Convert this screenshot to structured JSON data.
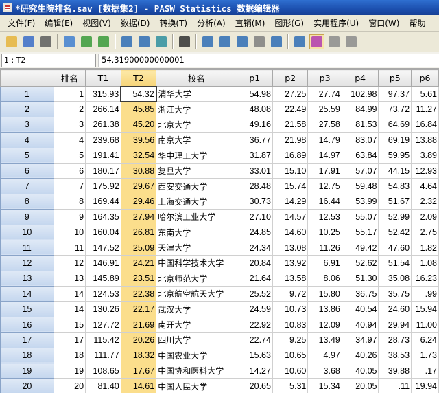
{
  "title": "*研究生院排名.sav [数据集2] - PASW Statistics 数据编辑器",
  "menu": [
    "文件(F)",
    "编辑(E)",
    "视图(V)",
    "数据(D)",
    "转换(T)",
    "分析(A)",
    "直销(M)",
    "图形(G)",
    "实用程序(U)",
    "窗口(W)",
    "帮助"
  ],
  "toolbar_icons": [
    "open-folder-icon",
    "save-icon",
    "print-icon",
    "dialog-recall-icon",
    "undo-icon",
    "redo-icon",
    "goto-case-icon",
    "goto-variable-icon",
    "variables-icon",
    "find-icon",
    "insert-cases-icon",
    "insert-variable-icon",
    "split-file-icon",
    "weight-cases-icon",
    "select-cases-icon",
    "value-labels-icon",
    "use-sets-icon",
    "show-all-variables-icon",
    "spell-check-icon"
  ],
  "cell_ref": "1 : T2",
  "cell_value": "54.31900000000001",
  "columns": [
    "排名",
    "T1",
    "T2",
    "校名",
    "p1",
    "p2",
    "p3",
    "p4",
    "p5",
    "p6"
  ],
  "rows": [
    {
      "n": "1",
      "v": [
        "1",
        "315.93",
        "54.32",
        "清华大学",
        "54.98",
        "27.25",
        "27.74",
        "102.98",
        "97.37",
        "5.61"
      ]
    },
    {
      "n": "2",
      "v": [
        "2",
        "266.14",
        "45.85",
        "浙江大学",
        "48.08",
        "22.49",
        "25.59",
        "84.99",
        "73.72",
        "11.27"
      ]
    },
    {
      "n": "3",
      "v": [
        "3",
        "261.38",
        "45.20",
        "北京大学",
        "49.16",
        "21.58",
        "27.58",
        "81.53",
        "64.69",
        "16.84"
      ]
    },
    {
      "n": "4",
      "v": [
        "4",
        "239.68",
        "39.56",
        "南京大学",
        "36.77",
        "21.98",
        "14.79",
        "83.07",
        "69.19",
        "13.88"
      ]
    },
    {
      "n": "5",
      "v": [
        "5",
        "191.41",
        "32.54",
        "华中理工大学",
        "31.87",
        "16.89",
        "14.97",
        "63.84",
        "59.95",
        "3.89"
      ]
    },
    {
      "n": "6",
      "v": [
        "6",
        "180.17",
        "30.88",
        "复旦大学",
        "33.01",
        "15.10",
        "17.91",
        "57.07",
        "44.15",
        "12.93"
      ]
    },
    {
      "n": "7",
      "v": [
        "7",
        "175.92",
        "29.67",
        "西安交通大学",
        "28.48",
        "15.74",
        "12.75",
        "59.48",
        "54.83",
        "4.64"
      ]
    },
    {
      "n": "8",
      "v": [
        "8",
        "169.44",
        "29.46",
        "上海交通大学",
        "30.73",
        "14.29",
        "16.44",
        "53.99",
        "51.67",
        "2.32"
      ]
    },
    {
      "n": "9",
      "v": [
        "9",
        "164.35",
        "27.94",
        "哈尔滨工业大学",
        "27.10",
        "14.57",
        "12.53",
        "55.07",
        "52.99",
        "2.09"
      ]
    },
    {
      "n": "10",
      "v": [
        "10",
        "160.04",
        "26.81",
        "东南大学",
        "24.85",
        "14.60",
        "10.25",
        "55.17",
        "52.42",
        "2.75"
      ]
    },
    {
      "n": "11",
      "v": [
        "11",
        "147.52",
        "25.09",
        "天津大学",
        "24.34",
        "13.08",
        "11.26",
        "49.42",
        "47.60",
        "1.82"
      ]
    },
    {
      "n": "12",
      "v": [
        "12",
        "146.91",
        "24.21",
        "中国科学技术大学",
        "20.84",
        "13.92",
        "6.91",
        "52.62",
        "51.54",
        "1.08"
      ]
    },
    {
      "n": "13",
      "v": [
        "13",
        "145.89",
        "23.51",
        "北京师范大学",
        "21.64",
        "13.58",
        "8.06",
        "51.30",
        "35.08",
        "16.23"
      ]
    },
    {
      "n": "14",
      "v": [
        "14",
        "124.53",
        "22.38",
        "北京航空航天大学",
        "25.52",
        "9.72",
        "15.80",
        "36.75",
        "35.75",
        ".99"
      ]
    },
    {
      "n": "15",
      "v": [
        "14",
        "130.26",
        "22.17",
        "武汉大学",
        "24.59",
        "10.73",
        "13.86",
        "40.54",
        "24.60",
        "15.94"
      ]
    },
    {
      "n": "16",
      "v": [
        "15",
        "127.72",
        "21.69",
        "南开大学",
        "22.92",
        "10.83",
        "12.09",
        "40.94",
        "29.94",
        "11.00"
      ]
    },
    {
      "n": "17",
      "v": [
        "17",
        "115.42",
        "20.26",
        "四川大学",
        "22.74",
        "9.25",
        "13.49",
        "34.97",
        "28.73",
        "6.24"
      ]
    },
    {
      "n": "18",
      "v": [
        "18",
        "111.77",
        "18.32",
        "中国农业大学",
        "15.63",
        "10.65",
        "4.97",
        "40.26",
        "38.53",
        "1.73"
      ]
    },
    {
      "n": "19",
      "v": [
        "19",
        "108.65",
        "17.67",
        "中国协和医科大学",
        "14.27",
        "10.60",
        "3.68",
        "40.05",
        "39.88",
        ".17"
      ]
    },
    {
      "n": "20",
      "v": [
        "20",
        "81.40",
        "14.61",
        "中国人民大学",
        "20.65",
        "5.31",
        "15.34",
        "20.05",
        ".11",
        "19.94"
      ]
    }
  ]
}
